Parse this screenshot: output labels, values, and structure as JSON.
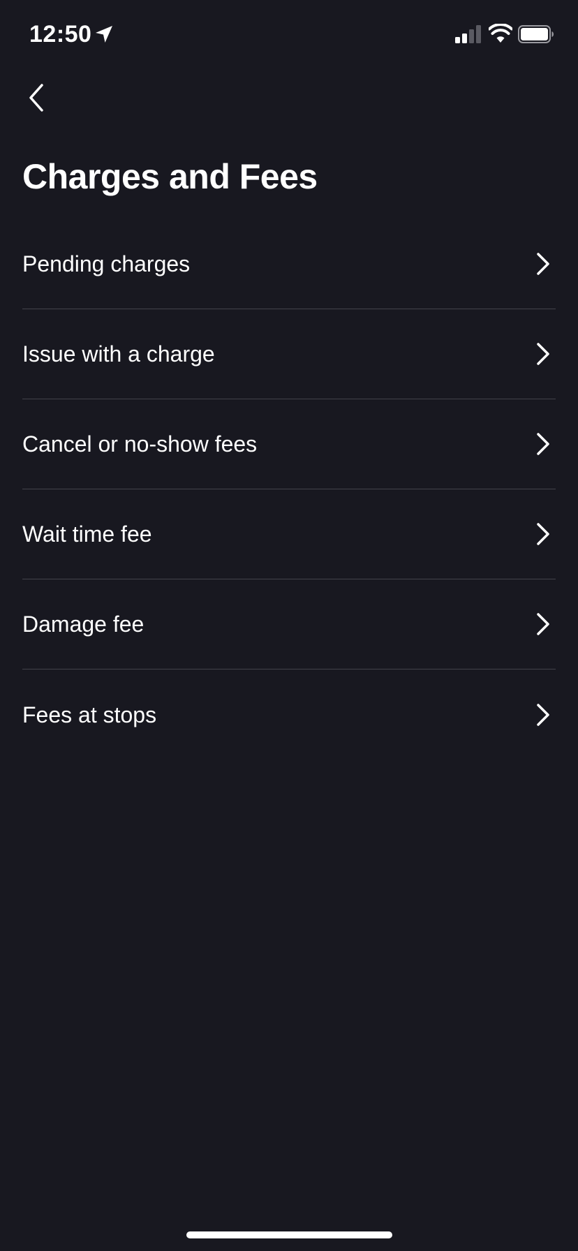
{
  "status_bar": {
    "time": "12:50",
    "location_icon": "location-arrow-icon",
    "signal_icon": "cellular-signal-icon",
    "wifi_icon": "wifi-icon",
    "battery_icon": "battery-icon"
  },
  "nav": {
    "back_icon": "chevron-left-icon"
  },
  "page": {
    "title": "Charges and Fees"
  },
  "menu": {
    "items": [
      {
        "label": "Pending charges"
      },
      {
        "label": "Issue with a charge"
      },
      {
        "label": "Cancel or no-show fees"
      },
      {
        "label": "Wait time fee"
      },
      {
        "label": "Damage fee"
      },
      {
        "label": "Fees at stops"
      }
    ],
    "chevron_icon": "chevron-right-icon"
  },
  "colors": {
    "background": "#181820",
    "text": "#ffffff",
    "divider": "#43434b"
  }
}
